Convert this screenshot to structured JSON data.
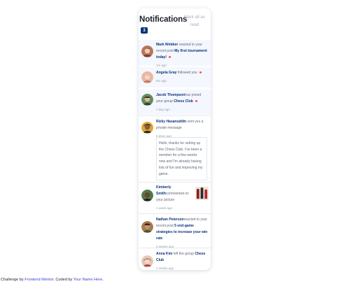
{
  "header": {
    "title": "Notifications",
    "badge": "3",
    "mark_all": "Mark all as read"
  },
  "notifications": [
    {
      "name": "Mark Webber",
      "action": " reacted to your recent post ",
      "target": "My first tournament today!",
      "time": "1m ago",
      "unread": true
    },
    {
      "name": "Angela Gray",
      "action": " followed you",
      "target": "",
      "time": "5m ago",
      "unread": true
    },
    {
      "name": "Jacob Thompson",
      "action": "has joined your group ",
      "target": "Chess Club",
      "time": "1 day ago",
      "unread": true
    },
    {
      "name": "Rizky Hasanuddin",
      "action": " sent you a private message",
      "target": "",
      "time": "5 days ago",
      "unread": false,
      "message": "Hello, thanks for setting up the Chess Club. I've been a member for a few weeks now and I'm already having lots of fun and improving my game."
    },
    {
      "name": "Kimberly Smith",
      "action": "commented on your picture",
      "target": "",
      "time": "1 week ago",
      "unread": false
    },
    {
      "name": "Nathan Peterson",
      "action": "reacted to your recent post ",
      "target": "5 end-game strategies to increase your win rate",
      "time": "2 weeks ago",
      "unread": false
    },
    {
      "name": "Anna Kim",
      "action": " left the group ",
      "target": "Chess Club",
      "time": "2 weeks ago",
      "unread": false
    }
  ],
  "footer": {
    "prefix": "Challenge by ",
    "challenge_link": "Frontend Mentor",
    "middle": ". Coded by ",
    "author_link": "Your Name Here",
    "suffix": "."
  },
  "colors": {
    "accent": "#0a327b",
    "unread_bg": "#f4f7fe",
    "dot": "#f65552",
    "link_blue": "#3e3fd6"
  }
}
